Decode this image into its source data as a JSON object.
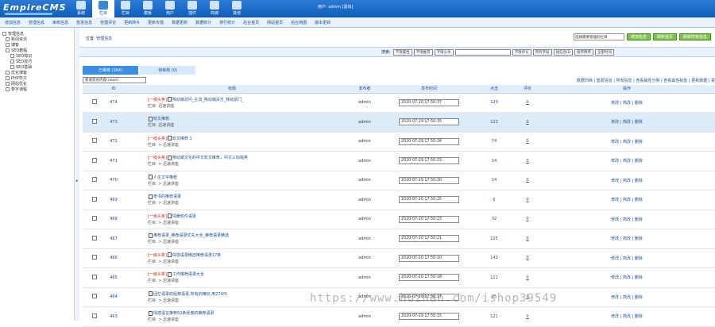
{
  "brand": {
    "logo": "EmpireCMS"
  },
  "topnav": [
    {
      "label": "系统",
      "icon": "system-icon",
      "active": false
    },
    {
      "label": "栏目",
      "icon": "edit-icon",
      "active": true
    },
    {
      "label": "栏目",
      "icon": "column-icon",
      "active": false
    },
    {
      "label": "模板",
      "icon": "template-icon",
      "active": false
    },
    {
      "label": "用户",
      "icon": "user-icon",
      "active": false
    },
    {
      "label": "插件",
      "icon": "plugin-icon",
      "active": false
    },
    {
      "label": "商城",
      "icon": "shop-icon",
      "active": false
    },
    {
      "label": "其他",
      "icon": "gear-icon",
      "active": false
    }
  ],
  "userbar": "用户: admin  [退出]",
  "subnav": [
    "增加信息",
    "管理信息",
    "审核信息",
    "签发信息",
    "管理评论",
    "更新碎片",
    "更新专题",
    "数据更新",
    "数据统计",
    "排行统计",
    "后台首页",
    "网站首页",
    "后台地图",
    "版本更新"
  ],
  "sidebar": [
    {
      "label": "管理信息",
      "level": 0
    },
    {
      "label": "新闻资讯",
      "level": 1
    },
    {
      "label": "博客",
      "level": 1
    },
    {
      "label": "SEO教程",
      "level": 1
    },
    {
      "label": "SEO知识",
      "level": 2
    },
    {
      "label": "SEO技巧",
      "level": 2
    },
    {
      "label": "SEO基础",
      "level": 2
    },
    {
      "label": "优化博客",
      "level": 1
    },
    {
      "label": "PHP学习",
      "level": 1
    },
    {
      "label": "网站优化",
      "level": 1
    },
    {
      "label": "数字课程",
      "level": 1
    }
  ],
  "breadcrumb": {
    "prefix": "位置:",
    "link": "管理信息"
  },
  "topright": {
    "select": "选择需要管理的栏目",
    "buttons": [
      "增加信息",
      "刷新首页",
      "刷新所有信息"
    ]
  },
  "search": {
    "label": "搜索:",
    "dropdowns_left": [
      "不限属性",
      "不限推荐",
      "不限头条"
    ],
    "dropdowns_right": [
      "不限评论",
      "所有字段",
      "按信息ID",
      "排序降序",
      "全部时间"
    ]
  },
  "tabs": [
    {
      "label": "已审核 (264)",
      "active": true
    },
    {
      "label": "待审核 (0)",
      "active": false
    }
  ],
  "toolrow": {
    "sort_select": "新闻资讯内容(news)",
    "links": "数据归档 | 签发信息 | 所有信息 | 查看属性分类 | 查看属性标签 | 更新数据 | 更"
  },
  "table": {
    "headers": [
      "",
      "ID",
      "标题",
      "发布者",
      "发布时间",
      "点击",
      "评论",
      "操作"
    ],
    "rows": [
      {
        "id": "474",
        "tag": "[一级头条]",
        "title": "移动端访问_主流_移动端关方_移动前门_",
        "cat": "栏目: 迅速讲座",
        "pub": "admin",
        "time": "2020-07-20 17:50:37",
        "hits": "120",
        "cmt": "0",
        "op": "修改 | 简改 | 删除",
        "hl": false
      },
      {
        "id": "473",
        "tag": "",
        "title": "软文推荐",
        "cat": "栏目: 迅速讲座",
        "pub": "admin",
        "time": "2020-07-29 17:50:35",
        "hits": "123",
        "cmt": "0",
        "op": "修改 | 简改 | 删除",
        "hl": true
      },
      {
        "id": "472",
        "tag": "[一级头条]",
        "title": "软文推荐 1",
        "cat": "栏目: > 迅速讲座",
        "pub": "admin",
        "time": "2020-07-29 17:50:34",
        "hits": "74",
        "cmt": "0",
        "op": "修改 | 简改 | 删除",
        "hl": false
      },
      {
        "id": "471",
        "tag": "[一级头条]",
        "title": "移动端文化的中文软文推荐，中文三标题类",
        "cat": "栏目: > 迅速讲座",
        "pub": "admin",
        "time": "2020-07-29 17:50:33",
        "hits": "14",
        "cmt": "0",
        "op": "修改 | 简改 | 删除",
        "hl": false
      },
      {
        "id": "470",
        "tag": "",
        "title": "人生文字推荐",
        "cat": "栏目: > 迅速讲座",
        "pub": "admin",
        "time": "2020-07-29 17:50:30",
        "hits": "14",
        "cmt": "0",
        "op": "修改 | 简改 | 删除",
        "hl": false
      },
      {
        "id": "469",
        "tag": "",
        "title": "奇书的推荐语录",
        "cat": "栏目: > 迅速讲座",
        "pub": "admin",
        "time": "2020-07-20 17:50:25",
        "hits": "6",
        "cmt": "0",
        "op": "修改 | 简改 | 删除",
        "hl": false
      },
      {
        "id": "468",
        "tag": "[一级头条]",
        "title": "情暖软件语录",
        "cat": "栏目: > 迅速讲座",
        "pub": "admin",
        "time": "2020-07-20 17:50:23",
        "hits": "32",
        "cmt": "0",
        "op": "修改 | 简改 | 删除",
        "hl": false
      },
      {
        "id": "467",
        "tag": "",
        "title": "推荐语录_推荐语录优先大全_推荐语录精选",
        "cat": "栏目: > 迅速讲座",
        "pub": "admin",
        "time": "2020-07-20 17:50:21",
        "hits": "115",
        "cmt": "0",
        "op": "修改 | 简改 | 删除",
        "hl": false
      },
      {
        "id": "466",
        "tag": "[一级头条]",
        "title": "情感语录精选推荐语录17条",
        "cat": "栏目: > 迅速讲座",
        "pub": "admin",
        "time": "2020-07-20 17:50:10",
        "hits": "143",
        "cmt": "0",
        "op": "修改 | 简改 | 删除",
        "hl": false
      },
      {
        "id": "465",
        "tag": "[一级头条]",
        "title": "工作推荐语录大全",
        "cat": "栏目: > 迅速讲座",
        "pub": "admin",
        "time": "2020-07-20 17:50:18",
        "hits": "111",
        "cmt": "0",
        "op": "修改 | 简改 | 删除",
        "hl": false
      },
      {
        "id": "464",
        "tag": "",
        "title": "回忆语录的经典语录,所有的精好,用274日",
        "cat": "栏目: > 迅速讲座",
        "pub": "admin",
        "time": "2020-07-29 17:50:17",
        "hits": "25",
        "cmt": "0",
        "op": "修改 | 简改 | 删除",
        "hl": false
      },
      {
        "id": "463",
        "tag": "",
        "title": "情感语言推荐50条经典的推荐语录",
        "cat": "栏目: > 迅速讲座",
        "pub": "admin",
        "time": "2020-07-29 17:50:15",
        "hits": "121",
        "cmt": "0",
        "op": "修改 | 简改 | 删除",
        "hl": false
      }
    ]
  },
  "watermark": "https://www.huzhan.com/ishop39549"
}
